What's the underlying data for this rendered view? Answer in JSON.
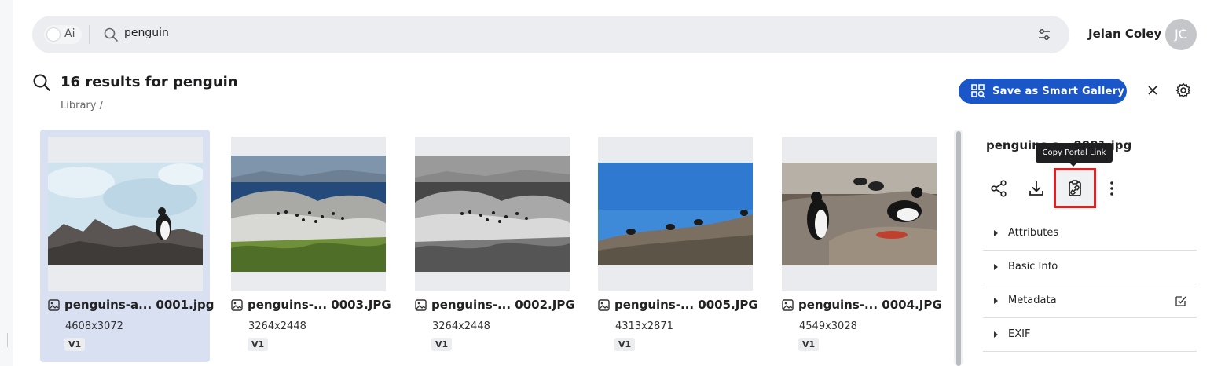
{
  "search": {
    "ai_label": "Ai",
    "query": "penguin"
  },
  "user": {
    "name": "Jelan Coley",
    "initials": "JC"
  },
  "results": {
    "title": "16 results for penguin",
    "breadcrumb": "Library  /"
  },
  "toolbar": {
    "smart_gallery_label": "Save as Smart Gallery"
  },
  "assets": [
    {
      "name": "penguins-a... 0001.jpg",
      "dims": "4608x3072",
      "version": "V1",
      "selected": true
    },
    {
      "name": "penguins-... 0003.JPG",
      "dims": "3264x2448",
      "version": "V1",
      "selected": false
    },
    {
      "name": "penguins-... 0002.JPG",
      "dims": "3264x2448",
      "version": "V1",
      "selected": false
    },
    {
      "name": "penguins-... 0005.JPG",
      "dims": "4313x2871",
      "version": "V1",
      "selected": false
    },
    {
      "name": "penguins-... 0004.JPG",
      "dims": "4549x3028",
      "version": "V1",
      "selected": false
    }
  ],
  "detail": {
    "title": "penguins-a...0001.jpg",
    "tooltip": "Copy Portal Link",
    "sections": [
      "Attributes",
      "Basic Info",
      "Metadata",
      "EXIF"
    ]
  },
  "icons": {
    "search": "search-icon",
    "filter": "sliders-icon",
    "close": "close-icon",
    "settings": "gear-icon",
    "share": "share-icon",
    "download": "download-icon",
    "copy_link": "copy-link-icon",
    "more": "more-vertical-icon",
    "image": "image-icon",
    "verified": "edit-check-icon"
  },
  "colors": {
    "accent": "#1a56c8",
    "selected_card": "#d8e0f2",
    "highlight": "#e02020"
  }
}
